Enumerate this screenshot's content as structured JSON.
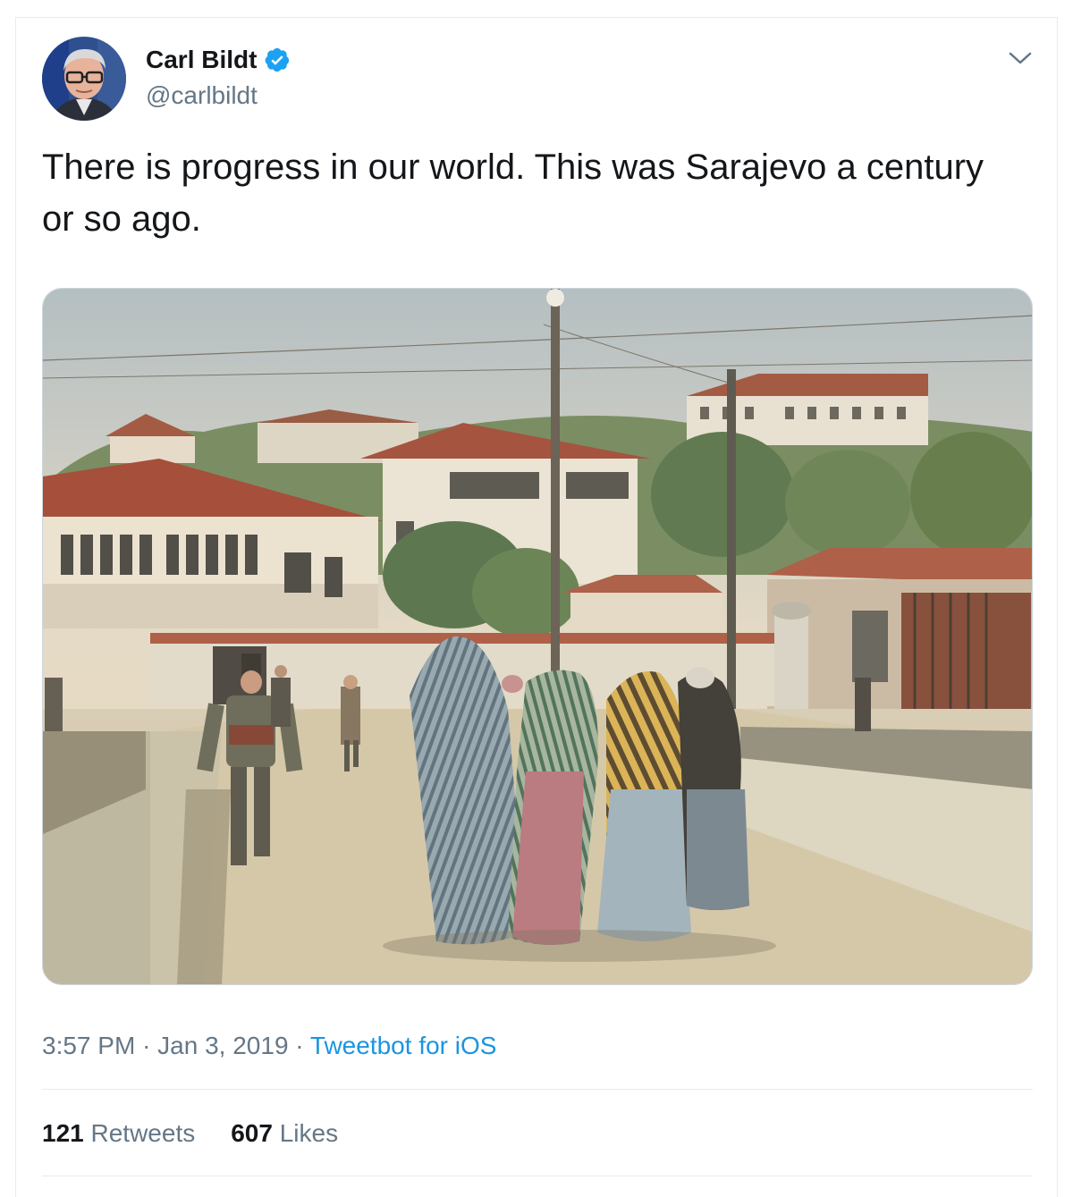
{
  "tweet": {
    "author": {
      "name": "Carl Bildt",
      "handle": "@carlbildt",
      "verified": true
    },
    "text": "There is progress in our world. This was Sarajevo a century or so ago.",
    "media": {
      "kind": "photo"
    },
    "time": "3:57 PM",
    "date": "Jan 3, 2019",
    "separator": "·",
    "source": "Tweetbot for iOS",
    "stats": {
      "retweets_count": "121",
      "retweets_label": "Retweets",
      "likes_count": "607",
      "likes_label": "Likes"
    }
  },
  "colors": {
    "verified": "#1da1f2",
    "link": "#1b95e0",
    "secondary_text": "#657786",
    "primary_text": "#14171a",
    "divider": "#e6ecf0"
  },
  "icons": {
    "verified": "verified-badge-icon",
    "caret": "chevron-down-icon"
  }
}
